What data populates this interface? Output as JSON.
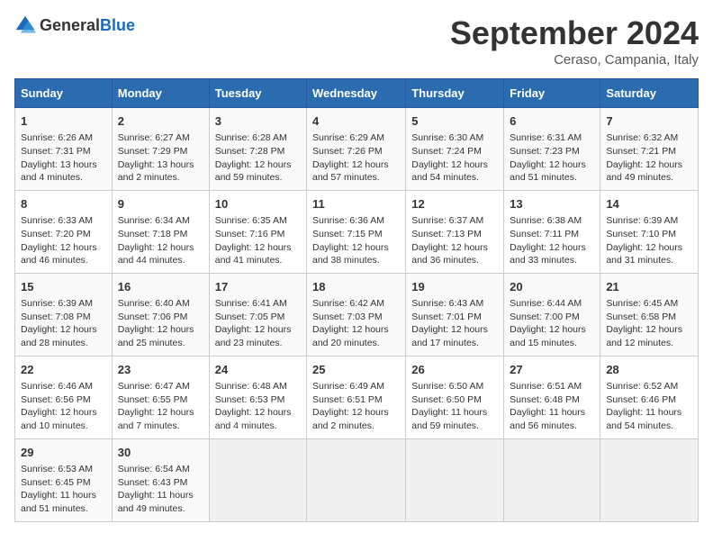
{
  "header": {
    "logo": {
      "text1": "General",
      "text2": "Blue"
    },
    "title": "September 2024",
    "location": "Ceraso, Campania, Italy"
  },
  "days_of_week": [
    "Sunday",
    "Monday",
    "Tuesday",
    "Wednesday",
    "Thursday",
    "Friday",
    "Saturday"
  ],
  "weeks": [
    [
      {
        "day": 1,
        "info": "Sunrise: 6:26 AM\nSunset: 7:31 PM\nDaylight: 13 hours and 4 minutes."
      },
      {
        "day": 2,
        "info": "Sunrise: 6:27 AM\nSunset: 7:29 PM\nDaylight: 13 hours and 2 minutes."
      },
      {
        "day": 3,
        "info": "Sunrise: 6:28 AM\nSunset: 7:28 PM\nDaylight: 12 hours and 59 minutes."
      },
      {
        "day": 4,
        "info": "Sunrise: 6:29 AM\nSunset: 7:26 PM\nDaylight: 12 hours and 57 minutes."
      },
      {
        "day": 5,
        "info": "Sunrise: 6:30 AM\nSunset: 7:24 PM\nDaylight: 12 hours and 54 minutes."
      },
      {
        "day": 6,
        "info": "Sunrise: 6:31 AM\nSunset: 7:23 PM\nDaylight: 12 hours and 51 minutes."
      },
      {
        "day": 7,
        "info": "Sunrise: 6:32 AM\nSunset: 7:21 PM\nDaylight: 12 hours and 49 minutes."
      }
    ],
    [
      {
        "day": 8,
        "info": "Sunrise: 6:33 AM\nSunset: 7:20 PM\nDaylight: 12 hours and 46 minutes."
      },
      {
        "day": 9,
        "info": "Sunrise: 6:34 AM\nSunset: 7:18 PM\nDaylight: 12 hours and 44 minutes."
      },
      {
        "day": 10,
        "info": "Sunrise: 6:35 AM\nSunset: 7:16 PM\nDaylight: 12 hours and 41 minutes."
      },
      {
        "day": 11,
        "info": "Sunrise: 6:36 AM\nSunset: 7:15 PM\nDaylight: 12 hours and 38 minutes."
      },
      {
        "day": 12,
        "info": "Sunrise: 6:37 AM\nSunset: 7:13 PM\nDaylight: 12 hours and 36 minutes."
      },
      {
        "day": 13,
        "info": "Sunrise: 6:38 AM\nSunset: 7:11 PM\nDaylight: 12 hours and 33 minutes."
      },
      {
        "day": 14,
        "info": "Sunrise: 6:39 AM\nSunset: 7:10 PM\nDaylight: 12 hours and 31 minutes."
      }
    ],
    [
      {
        "day": 15,
        "info": "Sunrise: 6:39 AM\nSunset: 7:08 PM\nDaylight: 12 hours and 28 minutes."
      },
      {
        "day": 16,
        "info": "Sunrise: 6:40 AM\nSunset: 7:06 PM\nDaylight: 12 hours and 25 minutes."
      },
      {
        "day": 17,
        "info": "Sunrise: 6:41 AM\nSunset: 7:05 PM\nDaylight: 12 hours and 23 minutes."
      },
      {
        "day": 18,
        "info": "Sunrise: 6:42 AM\nSunset: 7:03 PM\nDaylight: 12 hours and 20 minutes."
      },
      {
        "day": 19,
        "info": "Sunrise: 6:43 AM\nSunset: 7:01 PM\nDaylight: 12 hours and 17 minutes."
      },
      {
        "day": 20,
        "info": "Sunrise: 6:44 AM\nSunset: 7:00 PM\nDaylight: 12 hours and 15 minutes."
      },
      {
        "day": 21,
        "info": "Sunrise: 6:45 AM\nSunset: 6:58 PM\nDaylight: 12 hours and 12 minutes."
      }
    ],
    [
      {
        "day": 22,
        "info": "Sunrise: 6:46 AM\nSunset: 6:56 PM\nDaylight: 12 hours and 10 minutes."
      },
      {
        "day": 23,
        "info": "Sunrise: 6:47 AM\nSunset: 6:55 PM\nDaylight: 12 hours and 7 minutes."
      },
      {
        "day": 24,
        "info": "Sunrise: 6:48 AM\nSunset: 6:53 PM\nDaylight: 12 hours and 4 minutes."
      },
      {
        "day": 25,
        "info": "Sunrise: 6:49 AM\nSunset: 6:51 PM\nDaylight: 12 hours and 2 minutes."
      },
      {
        "day": 26,
        "info": "Sunrise: 6:50 AM\nSunset: 6:50 PM\nDaylight: 11 hours and 59 minutes."
      },
      {
        "day": 27,
        "info": "Sunrise: 6:51 AM\nSunset: 6:48 PM\nDaylight: 11 hours and 56 minutes."
      },
      {
        "day": 28,
        "info": "Sunrise: 6:52 AM\nSunset: 6:46 PM\nDaylight: 11 hours and 54 minutes."
      }
    ],
    [
      {
        "day": 29,
        "info": "Sunrise: 6:53 AM\nSunset: 6:45 PM\nDaylight: 11 hours and 51 minutes."
      },
      {
        "day": 30,
        "info": "Sunrise: 6:54 AM\nSunset: 6:43 PM\nDaylight: 11 hours and 49 minutes."
      },
      null,
      null,
      null,
      null,
      null
    ]
  ]
}
